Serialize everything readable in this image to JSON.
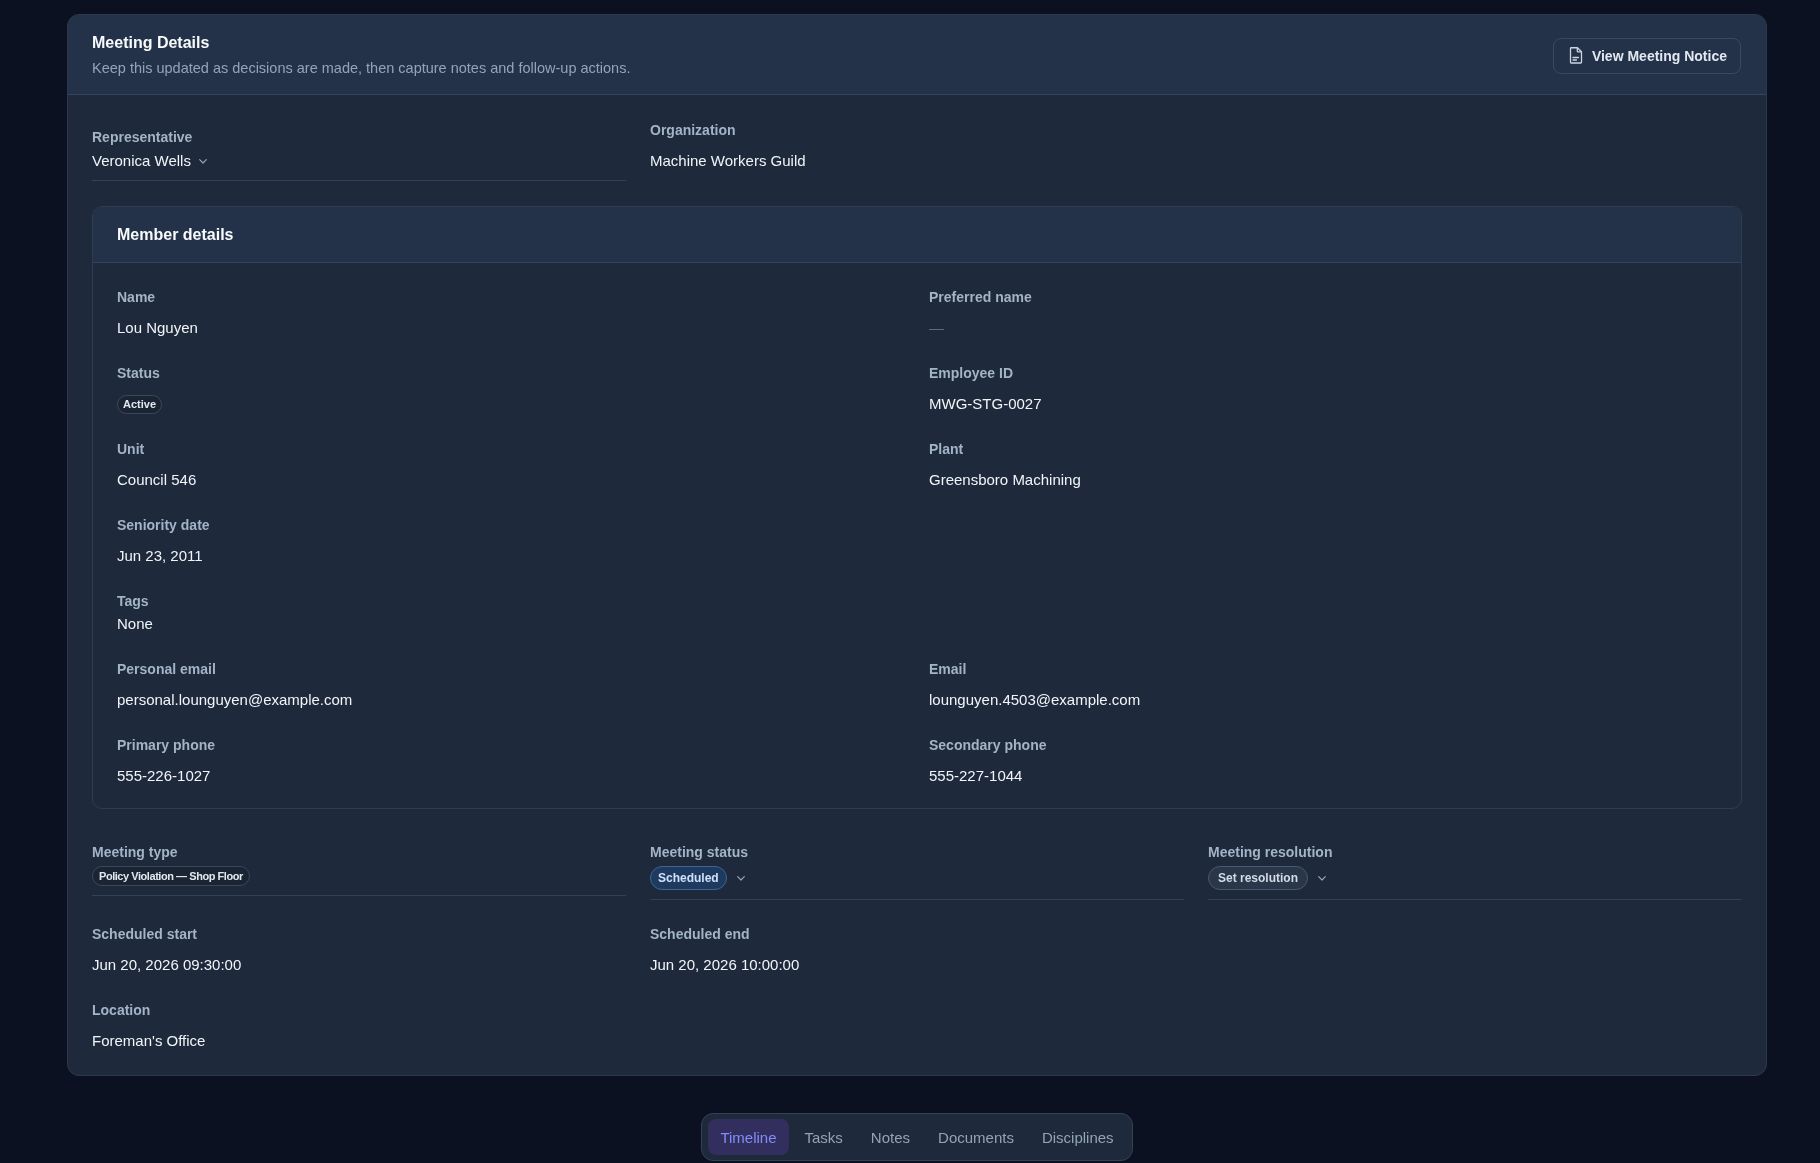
{
  "panel": {
    "title": "Meeting Details",
    "subtitle": "Keep this updated as decisions are made, then capture notes and follow-up actions.",
    "action_button": {
      "label": "View Meeting Notice"
    }
  },
  "assignment_fields": [
    {
      "kind": "select",
      "label": "Representative",
      "value": "Veronica Wells"
    },
    {
      "kind": "text",
      "label": "Organization",
      "value": "Machine Workers Guild"
    }
  ],
  "member_details": {
    "title": "Member details",
    "fields": [
      {
        "kind": "text",
        "label": "Name",
        "value": "Lou Nguyen"
      },
      {
        "kind": "empty",
        "label": "Preferred name",
        "value": "—"
      },
      {
        "kind": "badge",
        "label": "Status",
        "value": "Active"
      },
      {
        "kind": "text",
        "label": "Employee ID",
        "value": "MWG-STG-0027"
      },
      {
        "kind": "text",
        "label": "Unit",
        "value": "Council 546"
      },
      {
        "kind": "text",
        "label": "Plant",
        "value": "Greensboro Machining"
      },
      {
        "kind": "text",
        "label": "Seniority date",
        "value": "Jun 23, 2011"
      },
      {
        "kind": "tags",
        "label": "Tags",
        "value": "None"
      },
      {
        "kind": "text",
        "label": "Personal email",
        "value": "personal.lounguyen@example.com"
      },
      {
        "kind": "text",
        "label": "Email",
        "value": "lounguyen.4503@example.com"
      },
      {
        "kind": "text",
        "label": "Primary phone",
        "value": "555-226-1027"
      },
      {
        "kind": "text",
        "label": "Secondary phone",
        "value": "555-227-1044"
      }
    ]
  },
  "meeting_rows": [
    {
      "fields": [
        {
          "kind": "chip",
          "label": "Meeting type",
          "value": "Policy Violation — Shop Floor"
        },
        {
          "kind": "chip_select",
          "label": "Meeting status",
          "value": "Scheduled"
        },
        {
          "kind": "chip_select",
          "label": "Meeting resolution",
          "placeholder": "Set resolution"
        }
      ]
    },
    {
      "fields": [
        {
          "kind": "text",
          "label": "Scheduled start",
          "value": "Jun 20, 2026 09:30:00"
        },
        {
          "kind": "text",
          "label": "Scheduled end",
          "value": "Jun 20, 2026 10:00:00"
        }
      ]
    },
    {
      "fields": [
        {
          "kind": "text",
          "label": "Location",
          "value": "Foreman's Office"
        }
      ]
    }
  ],
  "tabs": [
    {
      "label": "Timeline",
      "selected": true
    },
    {
      "label": "Tasks",
      "selected": false
    },
    {
      "label": "Notes",
      "selected": false
    },
    {
      "label": "Documents",
      "selected": false
    },
    {
      "label": "Disciplines",
      "selected": false
    }
  ]
}
